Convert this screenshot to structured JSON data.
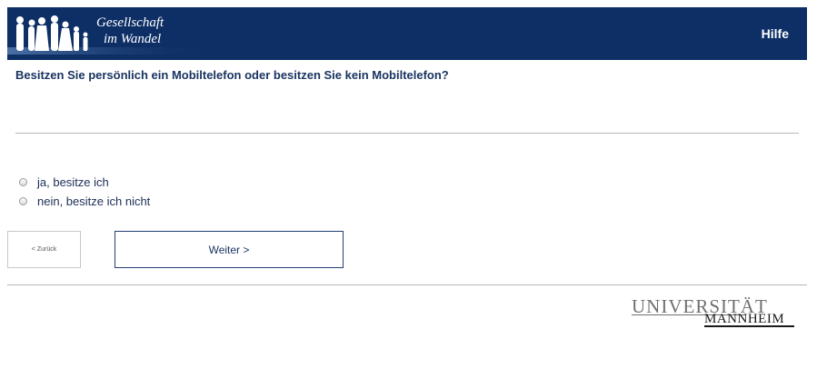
{
  "header": {
    "logo_line1": "Gesellschaft",
    "logo_line2": "im Wandel",
    "help_label": "Hilfe"
  },
  "question": {
    "text": "Besitzen Sie persönlich ein Mobiltelefon oder besitzen Sie kein Mobiltelefon?",
    "options": [
      {
        "label": "ja, besitze ich",
        "selected": false
      },
      {
        "label": "nein, besitze ich nicht",
        "selected": false
      }
    ]
  },
  "navigation": {
    "back_label": "< Zurück",
    "next_label": "Weiter >"
  },
  "footer": {
    "university_line1": "UNIVERSITÄT",
    "university_line2": "MANNHEIM"
  },
  "colors": {
    "header_bg": "#0d2f66",
    "text": "#18325f"
  }
}
